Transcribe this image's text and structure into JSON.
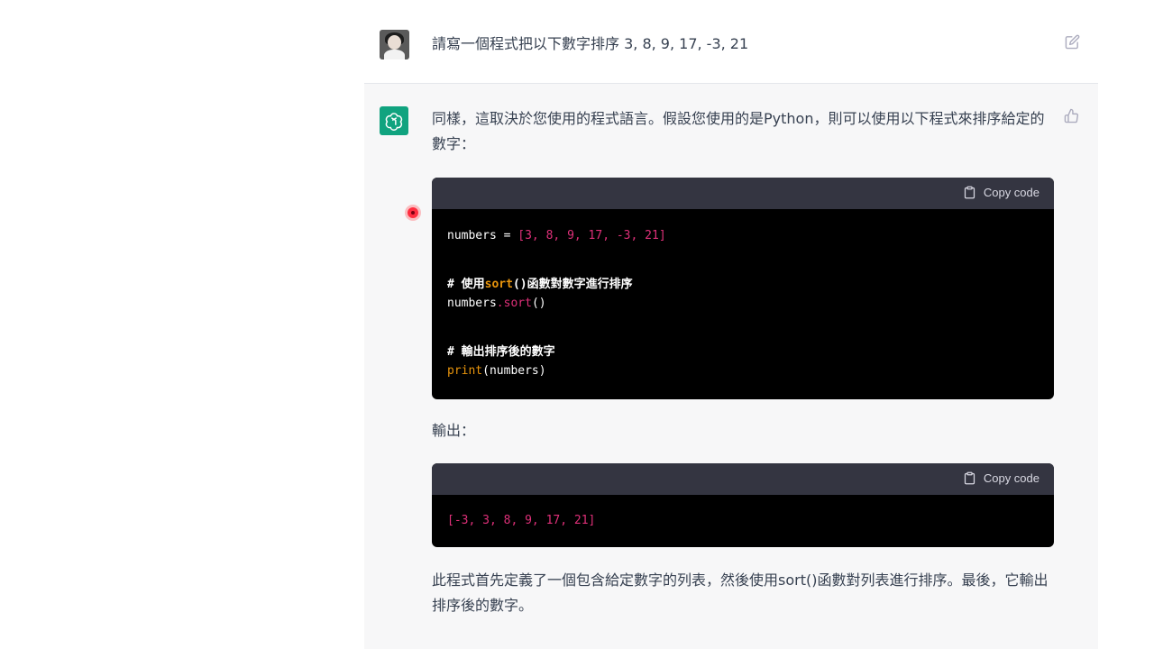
{
  "user": {
    "message": "請寫一個程式把以下數字排序 3, 8, 9, 17, -3, 21"
  },
  "assistant": {
    "intro": "同樣，這取決於您使用的程式語言。假設您使用的是Python，則可以使用以下程式來排序給定的數字：",
    "code_block_1": {
      "copy_label": "Copy code",
      "line1": {
        "name": "numbers",
        "op": " = ",
        "value": "[3, 8, 9, 17, -3, 21]"
      },
      "line2": {
        "comment_hash": "# 使用",
        "fn": "sort",
        "rest": "()函數對數字進行排序"
      },
      "line3": {
        "obj": "numbers",
        "dot": ".",
        "method": "sort",
        "parens": "()"
      },
      "line4": {
        "comment": "# 輸出排序後的數字"
      },
      "line5": {
        "fn": "print",
        "args": "(numbers)"
      }
    },
    "output_label": "輸出：",
    "code_block_2": {
      "copy_label": "Copy code",
      "output": "[-3, 3, 8, 9, 17, 21]"
    },
    "summary": "此程式首先定義了一個包含給定數字的列表，然後使用sort()函數對列表進行排序。最後，它輸出排序後的數字。"
  },
  "colors": {
    "accent": "#10a37f",
    "code_bg": "#000000",
    "code_header": "#343541",
    "string": "#df3079",
    "function": "#e9950c"
  }
}
